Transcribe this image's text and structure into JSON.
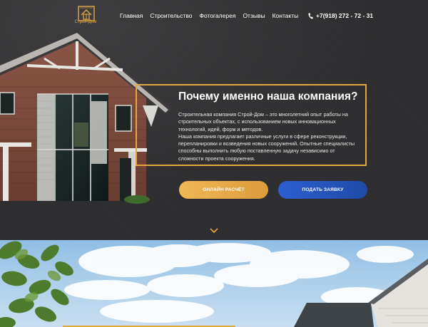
{
  "logo": {
    "label": "Строй-Дом",
    "icon": "house-blueprint-logo-icon"
  },
  "nav": {
    "items": [
      {
        "label": "Главная"
      },
      {
        "label": "Строительство"
      },
      {
        "label": "Фотогалерея"
      },
      {
        "label": "Отзывы"
      },
      {
        "label": "Контакты"
      }
    ]
  },
  "phone": {
    "icon": "phone-icon",
    "number": "+7(918) 272 - 72 - 31"
  },
  "hero": {
    "title": "Почему именно наша компания?",
    "paragraph1": "Строительная компания Строй-Дом – это многолетний опыт работы на строительных объектах, с использованием новых инновационных технологий, идей, форм и методов.",
    "paragraph2": "Наша компания предлагает различные услуги в сфере реконструкции, перепланировки и возведения новых сооружений. Опытные специалисты способны выполнить любую поставленную задачу независимо от сложности проекта сооружения."
  },
  "buttons": {
    "calc_label": "ОНЛАЙН РАСЧЁТ",
    "request_label": "ПОДАТЬ ЗАЯВКУ"
  },
  "scroll": {
    "icon": "chevron-down-icon"
  },
  "colors": {
    "accent": "#e4a740",
    "button_orange": "#e8a84a",
    "button_blue": "#2756c4",
    "background": "#2e2e30"
  }
}
